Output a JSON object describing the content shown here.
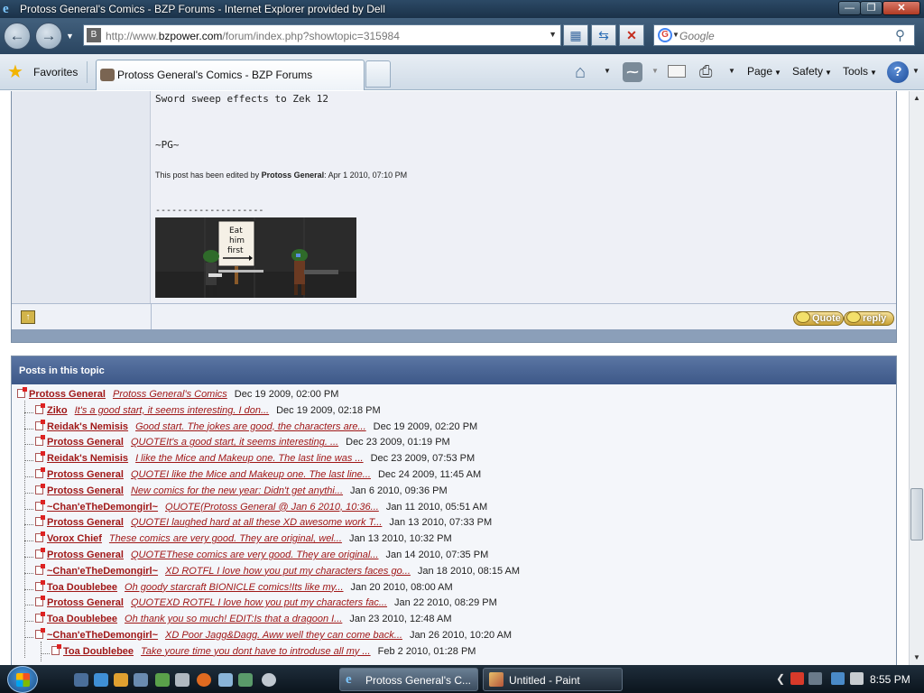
{
  "window": {
    "title": "Protoss General's Comics - BZP Forums - Internet Explorer provided by Dell",
    "min_label": "—",
    "max_label": "❐",
    "close_label": "✕"
  },
  "address": {
    "url_prefix": "http://www.",
    "url_domain": "bzpower.com",
    "url_rest": "/forum/index.php?showtopic=315984",
    "search_placeholder": "Google"
  },
  "commandbar": {
    "favorites_label": "Favorites",
    "tab_title": "Protoss General's Comics - BZP Forums",
    "page_label": "Page",
    "safety_label": "Safety",
    "tools_label": "Tools",
    "help_label": "?"
  },
  "post": {
    "line1": "Sword sweep effects to Zek 12",
    "signature": "~PG~",
    "edited_prefix": "This post has been edited by ",
    "edited_by": "Protoss General",
    "edited_suffix": ": Apr 1 2010, 07:10 PM",
    "dashes": "--------------------",
    "sign_text": [
      "Eat",
      "him",
      "first"
    ],
    "quote_label": "Quote",
    "reply_label": "reply"
  },
  "topic": {
    "header": "Posts in this topic",
    "rows": [
      {
        "author": "Protoss General",
        "snippet": "Protoss General's Comics",
        "date": "Dec 19 2009, 02:00 PM",
        "depth": 0
      },
      {
        "author": "Ziko",
        "snippet": "It's a good start, it seems interesting. I don...",
        "date": "Dec 19 2009, 02:18 PM",
        "depth": 1
      },
      {
        "author": "Reidak's Nemisis",
        "snippet": "Good start. The jokes are good, the characters are...",
        "date": "Dec 19 2009, 02:20 PM",
        "depth": 1
      },
      {
        "author": "Protoss General",
        "snippet": "QUOTEIt's a good start, it seems interesting. ...",
        "date": "Dec 23 2009, 01:19 PM",
        "depth": 1
      },
      {
        "author": "Reidak's Nemisis",
        "snippet": "I like the Mice and Makeup one. The last line was ...",
        "date": "Dec 23 2009, 07:53 PM",
        "depth": 1
      },
      {
        "author": "Protoss General",
        "snippet": "QUOTEI like the Mice and Makeup one. The last line...",
        "date": "Dec 24 2009, 11:45 AM",
        "depth": 1
      },
      {
        "author": "Protoss General",
        "snippet": "New comics for the new year: Didn't get anythi...",
        "date": "Jan 6 2010, 09:36 PM",
        "depth": 1
      },
      {
        "author": "~Chan'eTheDemongirl~",
        "snippet": "QUOTE(Protoss General @ Jan 6 2010, 10:36...",
        "date": "Jan 11 2010, 05:51 AM",
        "depth": 1
      },
      {
        "author": "Protoss General",
        "snippet": "QUOTEI laughed hard at all these XD awesome work T...",
        "date": "Jan 13 2010, 07:33 PM",
        "depth": 1
      },
      {
        "author": "Vorox Chief",
        "snippet": "These comics are very good. They are original, wel...",
        "date": "Jan 13 2010, 10:32 PM",
        "depth": 1
      },
      {
        "author": "Protoss General",
        "snippet": "QUOTEThese comics are very good. They are original...",
        "date": "Jan 14 2010, 07:35 PM",
        "depth": 1
      },
      {
        "author": "~Chan'eTheDemongirl~",
        "snippet": "XD ROTFL I love how you put my characters faces go...",
        "date": "Jan 18 2010, 08:15 AM",
        "depth": 1
      },
      {
        "author": "Toa Doublebee",
        "snippet": "Oh goody starcraft BIONICLE comics!Its like my...",
        "date": "Jan 20 2010, 08:00 AM",
        "depth": 1
      },
      {
        "author": "Protoss General",
        "snippet": "QUOTEXD ROTFL I love how you put my characters fac...",
        "date": "Jan 22 2010, 08:29 PM",
        "depth": 1
      },
      {
        "author": "Toa Doublebee",
        "snippet": "Oh thank you so much! EDIT:Is that a dragoon I...",
        "date": "Jan 23 2010, 12:48 AM",
        "depth": 1
      },
      {
        "author": "~Chan'eTheDemongirl~",
        "snippet": "XD Poor Jagg&Dagg. Aww well they can come back...",
        "date": "Jan 26 2010, 10:20 AM",
        "depth": 1
      },
      {
        "author": "Toa Doublebee",
        "snippet": "Take youre time you dont have to introduse all my ...",
        "date": "Feb 2 2010, 01:28 PM",
        "depth": 2
      }
    ]
  },
  "taskbar": {
    "ie_task": "Protoss General's C...",
    "paint_task": "Untitled - Paint",
    "clock": "8:55 PM"
  },
  "colors": {
    "link_red": "#a01818",
    "panel_header": "#4a6596"
  }
}
